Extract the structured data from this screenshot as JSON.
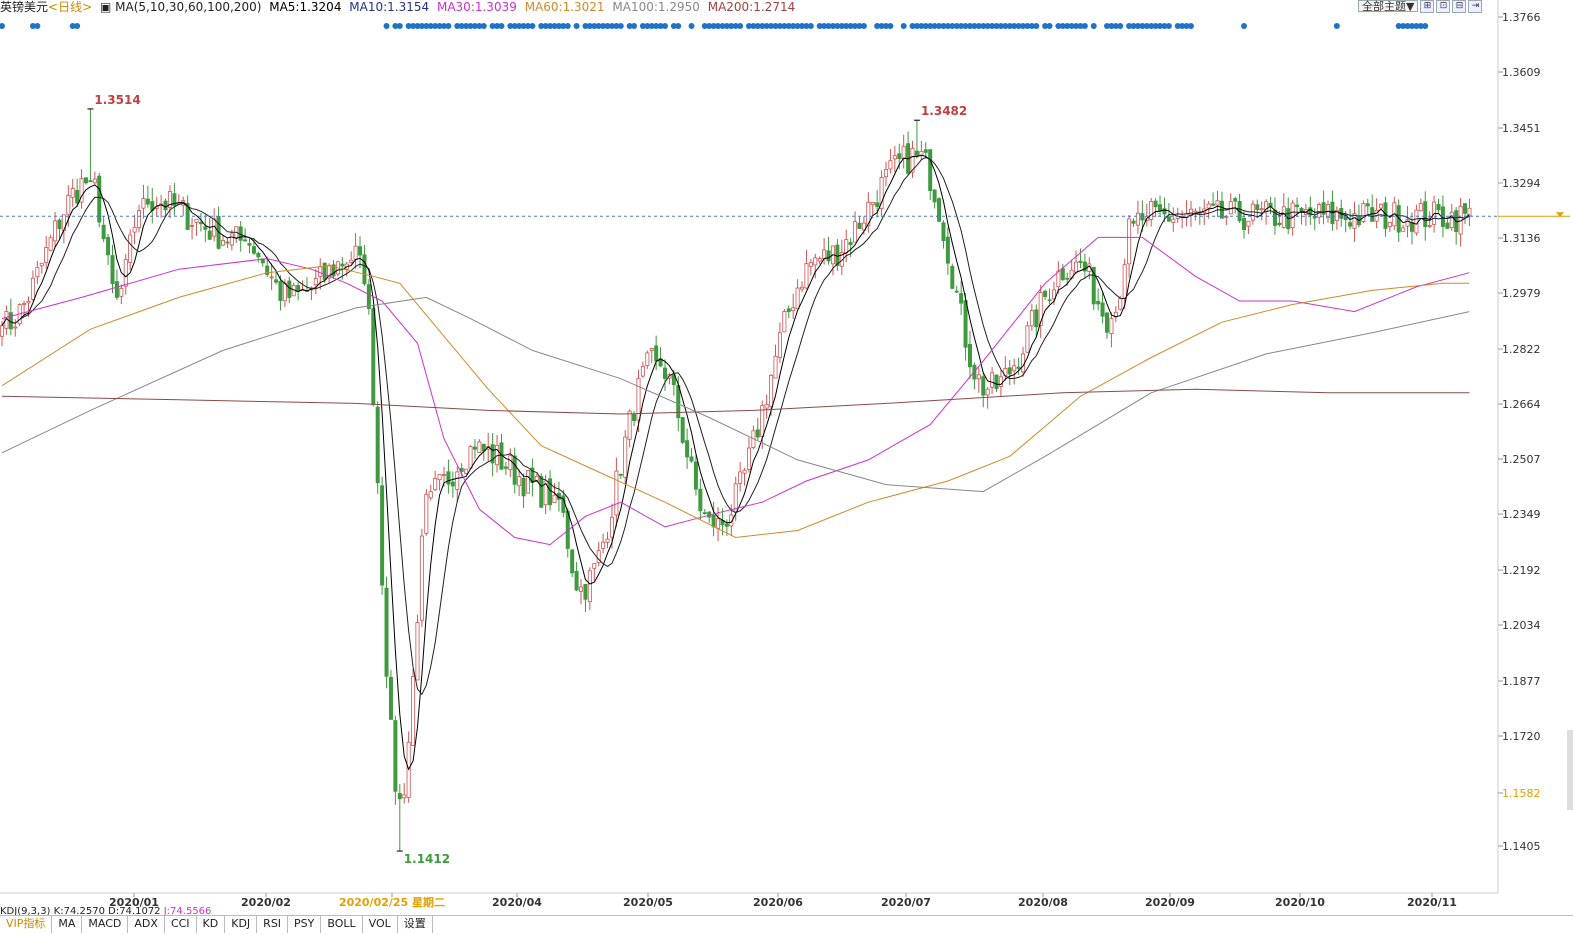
{
  "header": {
    "symbol": "英镑美元",
    "period": "<日线>",
    "ma_label": "MA(5,10,30,60,100,200)",
    "ma5": "MA5:1.3204",
    "ma10": "MA10:1.3154",
    "ma30": "MA30:1.3039",
    "ma60": "MA60:1.3021",
    "ma100": "MA100:1.2950",
    "ma200": "MA200:1.2714"
  },
  "controls": {
    "theme": "全部主题▼"
  },
  "colors": {
    "up": "#d05555",
    "down": "#3f9a3f",
    "ma5": "#000000",
    "ma10": "#222222",
    "ma30": "#cc33cc",
    "ma60": "#d08a2a",
    "ma100": "#888888",
    "ma200": "#8b4a4a",
    "dots": "#1e73c8",
    "price_line": "#4a78c0",
    "yellow": "#e0a000"
  },
  "kdj": {
    "label": "KDJ(9,3,3)",
    "k": "K:74.2570",
    "d": "D:74.1072",
    "j": "J:74.5566"
  },
  "tabs": [
    "VIP指标",
    "MA",
    "MACD",
    "ADX",
    "CCI",
    "KD",
    "KDJ",
    "RSI",
    "PSY",
    "BOLL",
    "VOL",
    "设置"
  ],
  "chart_data": {
    "type": "candlestick",
    "title": "英镑美元 <日线>",
    "ylim": [
      1.133,
      1.378
    ],
    "y_ticks": [
      "1.3766",
      "1.3609",
      "1.3451",
      "1.3294",
      "1.3136",
      "1.2979",
      "1.2822",
      "1.2664",
      "1.2507",
      "1.2349",
      "1.2192",
      "1.2034",
      "1.1877",
      "1.1720",
      "1.1582",
      "1.1405"
    ],
    "x_ticks": [
      "2020/01",
      "2020/02",
      "2020/02/25 星期二",
      "2020/04",
      "2020/05",
      "2020/06",
      "2020/07",
      "2020/08",
      "2020/09",
      "2020/10",
      "2020/11"
    ],
    "current_price": 1.321,
    "annotations": [
      {
        "text": "1.3514",
        "x": "2019/12/13",
        "y": 1.3514
      },
      {
        "text": "1.1412",
        "x": "2020/03/20",
        "y": 1.1412
      },
      {
        "text": "1.3482",
        "x": "2020/09/01",
        "y": 1.3482
      }
    ],
    "anchors": [
      {
        "date": "2019/11/15",
        "close": 1.29
      },
      {
        "date": "2019/12/13",
        "close": 1.331,
        "high": 1.3514
      },
      {
        "date": "2019/12/23",
        "close": 1.298
      },
      {
        "date": "2019/12/31",
        "close": 1.326
      },
      {
        "date": "2020/01/31",
        "close": 1.314
      },
      {
        "date": "2020/02/14",
        "close": 1.298
      },
      {
        "date": "2020/03/09",
        "close": 1.31
      },
      {
        "date": "2020/03/20",
        "close": 1.156,
        "low": 1.1412
      },
      {
        "date": "2020/03/31",
        "close": 1.243
      },
      {
        "date": "2020/04/14",
        "close": 1.255
      },
      {
        "date": "2020/05/08",
        "close": 1.242
      },
      {
        "date": "2020/05/18",
        "close": 1.216
      },
      {
        "date": "2020/06/10",
        "close": 1.28
      },
      {
        "date": "2020/06/29",
        "close": 1.233
      },
      {
        "date": "2020/07/31",
        "close": 1.309
      },
      {
        "date": "2020/09/01",
        "close": 1.338,
        "high": 1.3482
      },
      {
        "date": "2020/09/23",
        "close": 1.272
      },
      {
        "date": "2020/10/21",
        "close": 1.308
      },
      {
        "date": "2020/11/02",
        "close": 1.292
      },
      {
        "date": "2020/11/09",
        "close": 1.319
      },
      {
        "date": "2020/11/12",
        "close": 1.321
      }
    ],
    "ma_lines": {
      "ma30": [
        [
          0,
          1.292
        ],
        [
          18,
          1.298
        ],
        [
          40,
          1.306
        ],
        [
          60,
          1.309
        ],
        [
          70,
          1.306
        ],
        [
          78,
          1.302
        ],
        [
          86,
          1.297
        ],
        [
          94,
          1.285
        ],
        [
          100,
          1.258
        ],
        [
          108,
          1.238
        ],
        [
          116,
          1.23
        ],
        [
          124,
          1.228
        ],
        [
          132,
          1.236
        ],
        [
          140,
          1.24
        ],
        [
          150,
          1.233
        ],
        [
          162,
          1.237
        ],
        [
          172,
          1.24
        ],
        [
          182,
          1.246
        ],
        [
          196,
          1.252
        ],
        [
          210,
          1.262
        ],
        [
          222,
          1.28
        ],
        [
          236,
          1.302
        ],
        [
          248,
          1.315
        ],
        [
          258,
          1.315
        ],
        [
          270,
          1.304
        ],
        [
          280,
          1.297
        ],
        [
          292,
          1.297
        ],
        [
          306,
          1.294
        ],
        [
          320,
          1.301
        ],
        [
          332,
          1.305
        ]
      ],
      "ma60": [
        [
          0,
          1.273
        ],
        [
          20,
          1.289
        ],
        [
          40,
          1.298
        ],
        [
          60,
          1.305
        ],
        [
          74,
          1.307
        ],
        [
          84,
          1.304
        ],
        [
          90,
          1.302
        ],
        [
          100,
          1.287
        ],
        [
          110,
          1.272
        ],
        [
          122,
          1.256
        ],
        [
          136,
          1.248
        ],
        [
          150,
          1.24
        ],
        [
          166,
          1.23
        ],
        [
          180,
          1.232
        ],
        [
          196,
          1.24
        ],
        [
          214,
          1.246
        ],
        [
          228,
          1.253
        ],
        [
          244,
          1.27
        ],
        [
          260,
          1.281
        ],
        [
          276,
          1.291
        ],
        [
          292,
          1.296
        ],
        [
          310,
          1.3
        ],
        [
          326,
          1.302
        ],
        [
          332,
          1.302
        ]
      ],
      "ma100": [
        [
          0,
          1.254
        ],
        [
          20,
          1.266
        ],
        [
          50,
          1.283
        ],
        [
          80,
          1.295
        ],
        [
          96,
          1.298
        ],
        [
          106,
          1.292
        ],
        [
          120,
          1.283
        ],
        [
          140,
          1.275
        ],
        [
          160,
          1.264
        ],
        [
          180,
          1.252
        ],
        [
          200,
          1.245
        ],
        [
          222,
          1.243
        ],
        [
          236,
          1.253
        ],
        [
          260,
          1.271
        ],
        [
          286,
          1.282
        ],
        [
          310,
          1.288
        ],
        [
          332,
          1.294
        ]
      ],
      "ma200": [
        [
          0,
          1.27
        ],
        [
          40,
          1.269
        ],
        [
          80,
          1.268
        ],
        [
          110,
          1.266
        ],
        [
          140,
          1.265
        ],
        [
          170,
          1.266
        ],
        [
          200,
          1.268
        ],
        [
          240,
          1.271
        ],
        [
          270,
          1.272
        ],
        [
          300,
          1.271
        ],
        [
          332,
          1.271
        ]
      ]
    },
    "num_bars": 333,
    "signal_dots": "blue markers along top of chart"
  }
}
